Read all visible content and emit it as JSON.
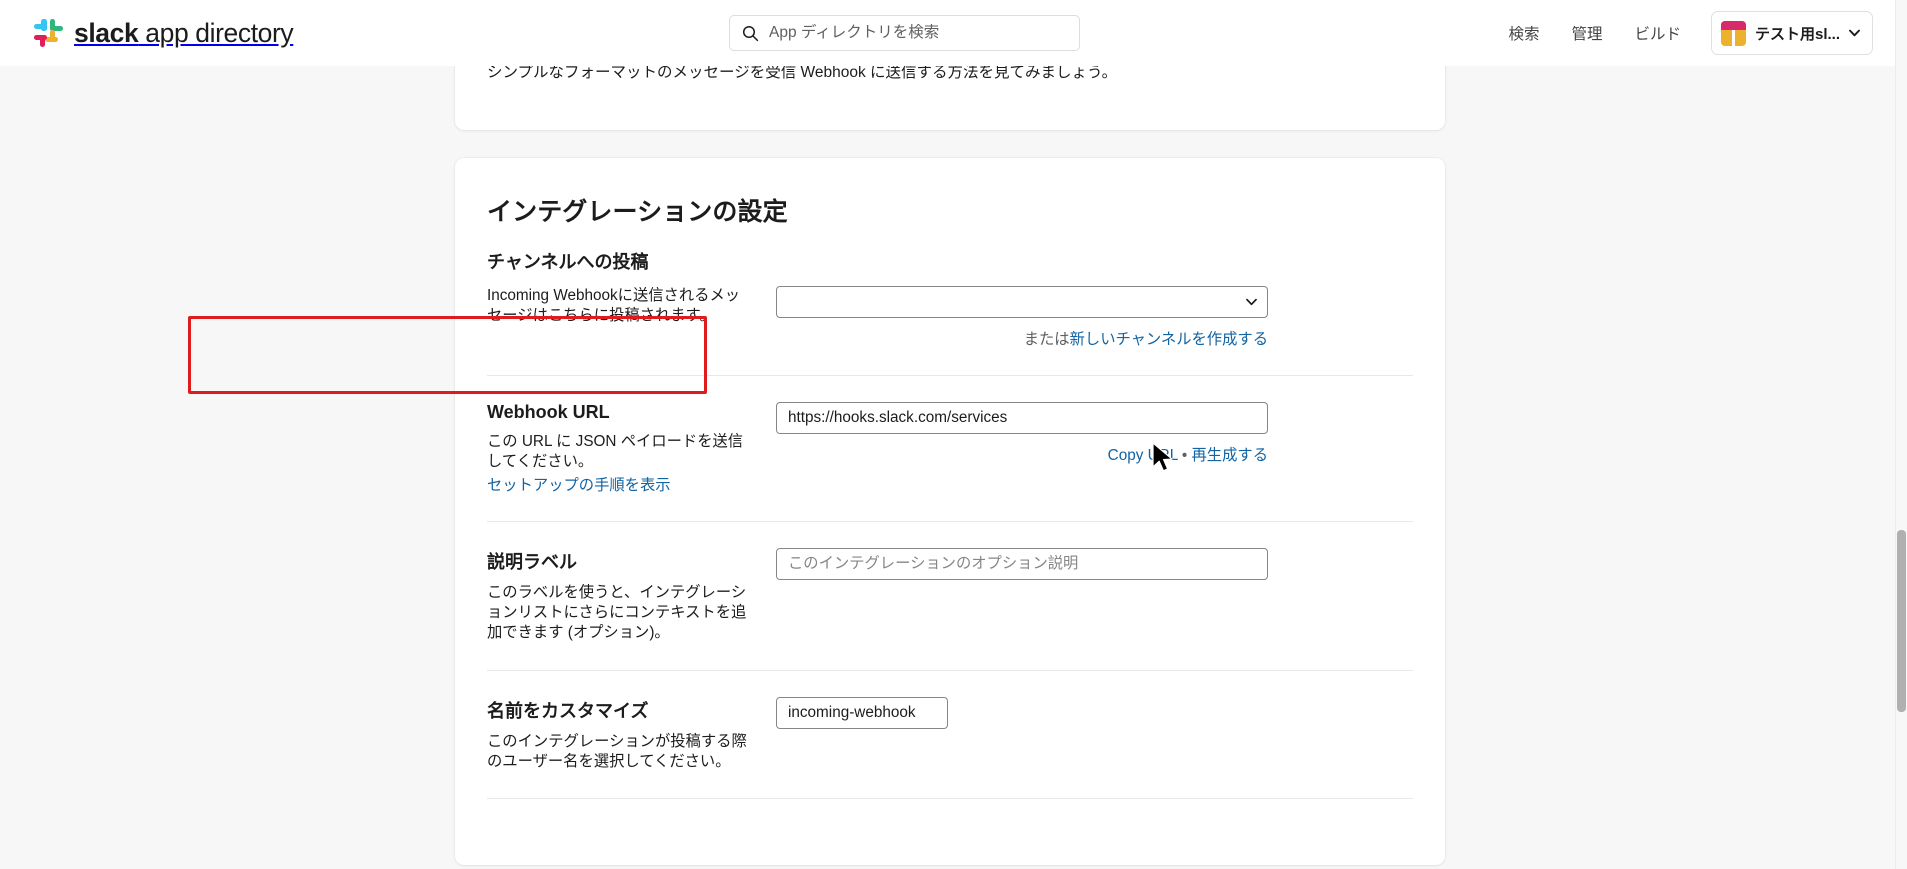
{
  "header": {
    "brand_bold": "slack",
    "brand_light": " app directory",
    "logo_icon": "slack-logo-icon",
    "search": {
      "placeholder": "App ディレクトリを検索",
      "value": "",
      "icon": "search-icon"
    },
    "nav": [
      {
        "label": "検索"
      },
      {
        "label": "管理"
      },
      {
        "label": "ビルド"
      }
    ],
    "workspace": {
      "name": "テスト用sl...",
      "avatar_icon": "workspace-avatar",
      "caret_icon": "chevron-down-icon",
      "avatar_colors": {
        "top": "#D62A6A",
        "bottom": "#ECB22E"
      }
    }
  },
  "clipped_card": {
    "text": "シンプルなフォーマットのメッセージを受信 Webhook に送信する方法を見てみましょう。"
  },
  "main": {
    "section_title": "インテグレーションの設定",
    "post_to_channel": {
      "heading": "チャンネルへの投稿",
      "description": "Incoming Webhookに送信されるメッセージはこちらに投稿されます。",
      "select_value": "",
      "select_caret_icon": "chevron-down-icon",
      "or_text": "または",
      "create_channel_link": "新しいチャンネルを作成する"
    },
    "webhook_url": {
      "label": "Webhook URL",
      "description": "この URL に JSON ペイロードを送信してください。",
      "setup_link": "セットアップの手順を表示",
      "value": "https://hooks.slack.com/services",
      "copy_link": "Copy URL",
      "separator": "•",
      "regenerate_link": "再生成する"
    },
    "description_label": {
      "label": "説明ラベル",
      "description": "このラベルを使うと、インテグレーションリストにさらにコンテキストを追加できます (オプション)。",
      "value": "",
      "placeholder": "このインテグレーションのオプション説明"
    },
    "customize_name": {
      "label": "名前をカスタマイズ",
      "description": "このインテグレーションが投稿する際のユーザー名を選択してください。",
      "value": "incoming-webhook",
      "placeholder": "incoming-webhook"
    }
  },
  "annotation": {
    "highlight_color": "#e01b1b",
    "cursor_icon": "mouse-pointer-icon"
  },
  "colors": {
    "page_background": "#f7f7f7",
    "card_background": "#ffffff",
    "link_blue": "#1264a3",
    "text_primary": "#1d1c1d",
    "text_muted": "#616061"
  }
}
